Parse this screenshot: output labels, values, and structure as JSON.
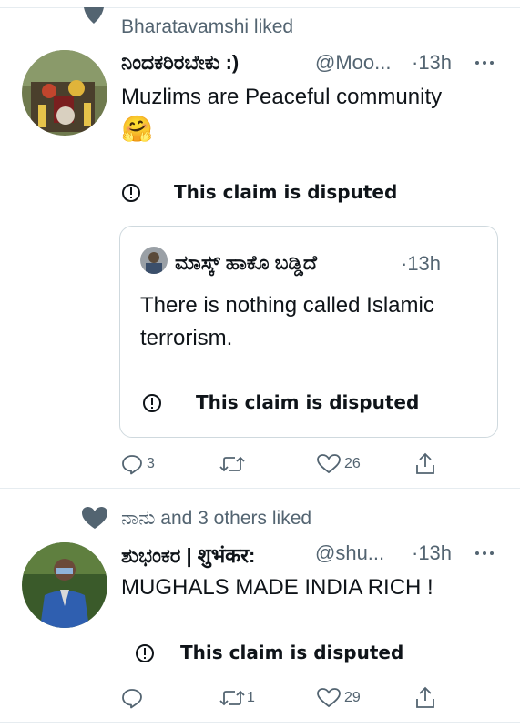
{
  "tweets": [
    {
      "context": "Bharatavamshi liked",
      "name": "ನಿಂದಕರಿರಬೇಕು :)",
      "handle": "@Moo...",
      "time": "·13h",
      "text": "Muzlims are Peaceful community",
      "emoji": "🤗",
      "notice": "This claim is disputed",
      "quote": {
        "name": "ಮಾಸ್ಕ್ ಹಾಕೊ ಬಡ್ಡಿದೆ",
        "time": "·13h",
        "text_line1": "There is nothing called Islamic",
        "text_line2": "terrorism.",
        "notice": "This claim is disputed"
      },
      "actions": {
        "replies": "3",
        "retweets": "",
        "likes": "26"
      }
    },
    {
      "context": "ನಾನು and 3 others liked",
      "name": "ಶುಭಂಕರ | शुभंकर:",
      "handle": "@shu...",
      "time": "·13h",
      "text": "MUGHALS MADE INDIA RICH !",
      "notice": "This claim is disputed",
      "actions": {
        "replies": "",
        "retweets": "1",
        "likes": "29"
      }
    }
  ],
  "colors": {
    "text": "#0f1419",
    "secondary": "#536471",
    "border": "#cfd9de",
    "heart": "#536471"
  }
}
